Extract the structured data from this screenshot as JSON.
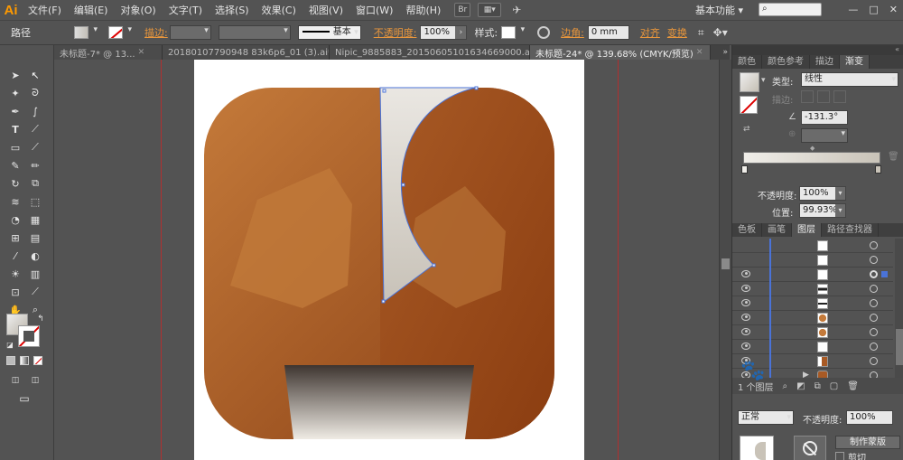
{
  "app": {
    "logo": "Ai"
  },
  "menubar": {
    "items": [
      "文件(F)",
      "编辑(E)",
      "对象(O)",
      "文字(T)",
      "选择(S)",
      "效果(C)",
      "视图(V)",
      "窗口(W)",
      "帮助(H)"
    ],
    "br_label": "Br",
    "workspace": "基本功能",
    "search_placeholder": "",
    "window_controls": [
      "—",
      "□",
      "✕"
    ]
  },
  "control_bar": {
    "object_type": "路径",
    "stroke_label": "描边:",
    "stroke_style": "基本",
    "opacity_label": "不透明度:",
    "opacity_value": "100%",
    "style_label": "样式:",
    "corner_label": "边角:",
    "corner_value": "0 mm",
    "align_label": "对齐",
    "transform_label": "变换"
  },
  "tabs": [
    {
      "label": "未标题-7* @ 13...",
      "active": false
    },
    {
      "label": "20180107790948 83k6p6_01 (3).ai*",
      "active": false
    },
    {
      "label": "Nipic_9885883_20150605101634669000.ai*",
      "active": false
    },
    {
      "label": "未标题-24* @ 139.68% (CMYK/预览)",
      "active": true
    }
  ],
  "right_panel": {
    "gradient_tabs": [
      "颜色",
      "颜色参考",
      "描边",
      "渐变"
    ],
    "gradient_active": "渐变",
    "type_label": "类型:",
    "type_value": "线性",
    "stroke_label": "描边:",
    "angle_value": "-131.3°",
    "opacity_label": "不透明度:",
    "opacity_value": "100%",
    "position_label": "位置:",
    "position_value": "99.93%",
    "layers_tabs": [
      "色板",
      "画笔",
      "图层",
      "路径查找器"
    ],
    "layers_active": "图层",
    "layer_count_label": "1 个图层",
    "transparency_mode": "正常",
    "transparency_label": "不透明度:",
    "transparency_value": "100%",
    "make_mask_label": "制作蒙版",
    "clip_label": "剪切"
  },
  "colors": {
    "background": "#535353",
    "accent_orange": "#e8963c",
    "logo": "#ff9a00",
    "icon_brown_light": "#c47a3a",
    "icon_brown_dark": "#8a4015",
    "selection_blue": "#4a73d8",
    "guide_red": "#b03030"
  },
  "layers": [
    {
      "visible": false,
      "expand": false,
      "thumb": "white-icon-glyph"
    },
    {
      "visible": false,
      "expand": false,
      "thumb": "white-icon-glyph"
    },
    {
      "visible": true,
      "expand": false,
      "thumb": "white-shape",
      "selected": true
    },
    {
      "visible": true,
      "expand": false,
      "thumb": "black-bar"
    },
    {
      "visible": true,
      "expand": false,
      "thumb": "black-bar-thin"
    },
    {
      "visible": true,
      "expand": false,
      "thumb": "orange-blob"
    },
    {
      "visible": true,
      "expand": false,
      "thumb": "orange-blob"
    },
    {
      "visible": true,
      "expand": false,
      "thumb": "white"
    },
    {
      "visible": true,
      "expand": false,
      "thumb": "orange-half"
    },
    {
      "visible": true,
      "expand": true,
      "thumb": "orange-rounded"
    }
  ]
}
